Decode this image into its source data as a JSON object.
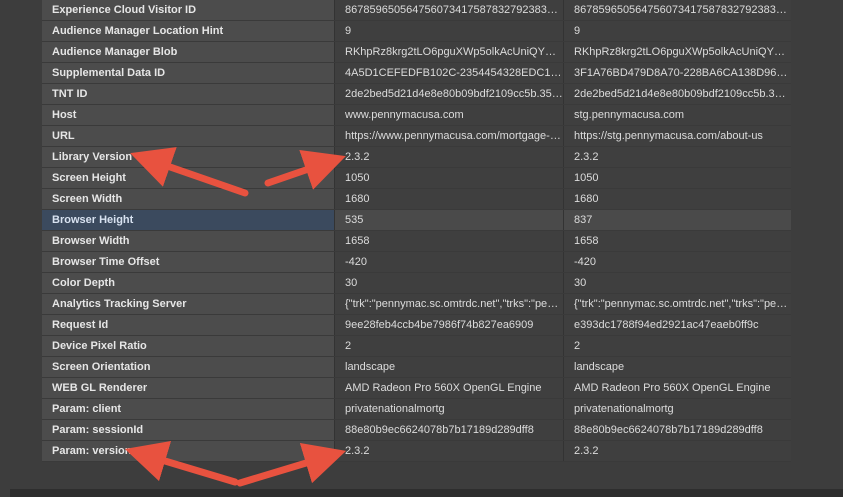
{
  "rows": [
    {
      "label": "Experience Cloud Visitor ID",
      "v1": "86785965056475607341758783279238332897",
      "v2": "86785965056475607341758783279238332897"
    },
    {
      "label": "Audience Manager Location Hint",
      "v1": "9",
      "v2": "9"
    },
    {
      "label": "Audience Manager Blob",
      "v1": "RKhpRz8krg2tLO6pguXWp5olkAcUniQYPHa...",
      "v2": "RKhpRz8krg2tLO6pguXWp5olkAcUniQYPHa..."
    },
    {
      "label": "Supplemental Data ID",
      "v1": "4A5D1CEFEDFB102C-2354454328EDC1DB",
      "v2": "3F1A76BD479D8A70-228BA6CA138D96CD"
    },
    {
      "label": "TNT ID",
      "v1": "2de2bed5d21d4e8e80b09bdf2109cc5b.35_0",
      "v2": "2de2bed5d21d4e8e80b09bdf2109cc5b.35_0"
    },
    {
      "label": "Host",
      "v1": "www.pennymacusa.com",
      "v2": "stg.pennymacusa.com"
    },
    {
      "label": "URL",
      "v1": "https://www.pennymacusa.com/mortgage-c...",
      "v2": "https://stg.pennymacusa.com/about-us"
    },
    {
      "label": "Library Version",
      "v1": "2.3.2",
      "v2": "2.3.2"
    },
    {
      "label": "Screen Height",
      "v1": "1050",
      "v2": "1050"
    },
    {
      "label": "Screen Width",
      "v1": "1680",
      "v2": "1680"
    },
    {
      "label": "Browser Height",
      "v1": "535",
      "v2": "837",
      "selected": true
    },
    {
      "label": "Browser Width",
      "v1": "1658",
      "v2": "1658"
    },
    {
      "label": "Browser Time Offset",
      "v1": "-420",
      "v2": "-420"
    },
    {
      "label": "Color Depth",
      "v1": "30",
      "v2": "30"
    },
    {
      "label": "Analytics Tracking Server",
      "v1": "{\"trk\":\"pennymac.sc.omtrdc.net\",\"trks\":\"penn...",
      "v2": "{\"trk\":\"pennymac.sc.omtrdc.net\",\"trks\":\"penn..."
    },
    {
      "label": "Request Id",
      "v1": "9ee28feb4ccb4be7986f74b827ea6909",
      "v2": "e393dc1788f94ed2921ac47eaeb0ff9c"
    },
    {
      "label": "Device Pixel Ratio",
      "v1": "2",
      "v2": "2"
    },
    {
      "label": "Screen Orientation",
      "v1": "landscape",
      "v2": "landscape"
    },
    {
      "label": "WEB GL Renderer",
      "v1": "AMD Radeon Pro 560X OpenGL Engine",
      "v2": "AMD Radeon Pro 560X OpenGL Engine"
    },
    {
      "label": "Param: client",
      "v1": "privatenationalmortg",
      "v2": "privatenationalmortg"
    },
    {
      "label": "Param: sessionId",
      "v1": "88e80b9ec6624078b7b17189d289dff8",
      "v2": "88e80b9ec6624078b7b17189d289dff8"
    },
    {
      "label": "Param: version",
      "v1": "2.3.2",
      "v2": "2.3.2"
    }
  ],
  "colors": {
    "arrow": "#e8523f",
    "selected_row": "#3b4a5e"
  }
}
